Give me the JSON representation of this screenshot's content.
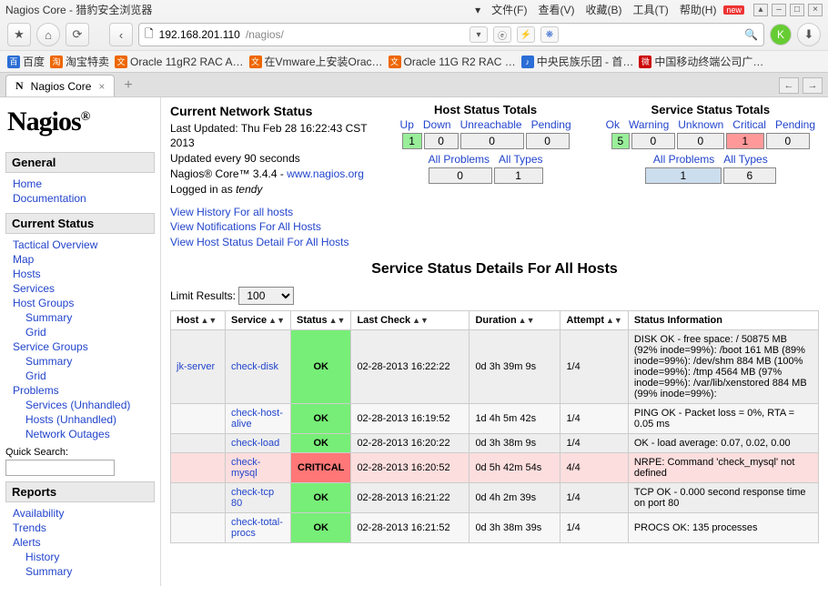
{
  "browser": {
    "title": "Nagios Core - 猎豹安全浏览器",
    "menus": [
      "文件(F)",
      "查看(V)",
      "收藏(B)",
      "工具(T)",
      "帮助(H)"
    ],
    "url_host": "192.168.201.110",
    "url_path": "/nagios/",
    "bookmarks": [
      "百度",
      "淘宝特卖",
      "Oracle 11gR2 RAC A…",
      "在Vmware上安装Orac…",
      "Oracle 11G R2 RAC …",
      "中央民族乐团 - 首…",
      "中国移动终端公司广…"
    ],
    "tab_label": "Nagios Core"
  },
  "sidebar": {
    "logo": "Nagios",
    "general_head": "General",
    "general": [
      "Home",
      "Documentation"
    ],
    "curstat_head": "Current Status",
    "curstat_top": [
      "Tactical Overview",
      "Map",
      "Hosts",
      "Services"
    ],
    "hostgroups_head": "Host Groups",
    "sub1": [
      "Summary",
      "Grid"
    ],
    "servicegroups_head": "Service Groups",
    "sub2": [
      "Summary",
      "Grid"
    ],
    "problems_head": "Problems",
    "problems": [
      "Services (Unhandled)",
      "Hosts (Unhandled)",
      "Network Outages"
    ],
    "quick_search": "Quick Search:",
    "reports_head": "Reports",
    "reports": [
      "Availability",
      "Trends",
      "Alerts"
    ],
    "alerts_sub": [
      "History",
      "Summary"
    ]
  },
  "status": {
    "title": "Current Network Status",
    "updated": "Last Updated: Thu Feb 28 16:22:43 CST 2013",
    "interval": "Updated every 90 seconds",
    "version_pre": "Nagios® Core™ 3.4.4 - ",
    "version_link": "www.nagios.org",
    "login_pre": "Logged in as ",
    "login_user": "tendy",
    "links": [
      "View History For all hosts",
      "View Notifications For All Hosts",
      "View Host Status Detail For All Hosts"
    ]
  },
  "host_totals": {
    "title": "Host Status Totals",
    "labels": [
      "Up",
      "Down",
      "Unreachable",
      "Pending"
    ],
    "counts": [
      "1",
      "0",
      "0",
      "0"
    ],
    "sub_labels": [
      "All Problems",
      "All Types"
    ],
    "sub_counts": [
      "0",
      "1"
    ]
  },
  "svc_totals": {
    "title": "Service Status Totals",
    "labels": [
      "Ok",
      "Warning",
      "Unknown",
      "Critical",
      "Pending"
    ],
    "counts": [
      "5",
      "0",
      "0",
      "1",
      "0"
    ],
    "sub_labels": [
      "All Problems",
      "All Types"
    ],
    "sub_counts": [
      "1",
      "6"
    ]
  },
  "details_title": "Service Status Details For All Hosts",
  "limit": {
    "label": "Limit Results:",
    "value": "100"
  },
  "columns": [
    "Host",
    "Service",
    "Status",
    "Last Check",
    "Duration",
    "Attempt",
    "Status Information"
  ],
  "rows": [
    {
      "host": "jk-server",
      "service": "check-disk",
      "status": "OK",
      "status_class": "ok",
      "last": "02-28-2013 16:22:22",
      "dur": "0d 3h 39m 9s",
      "att": "1/4",
      "info": "DISK OK - free space: / 50875 MB (92% inode=99%): /boot 161 MB (89% inode=99%): /dev/shm 884 MB (100% inode=99%): /tmp 4564 MB (97% inode=99%): /var/lib/xenstored 884 MB (99% inode=99%):",
      "row": "even"
    },
    {
      "host": "",
      "service": "check-host-alive",
      "status": "OK",
      "status_class": "ok",
      "last": "02-28-2013 16:19:52",
      "dur": "1d 4h 5m 42s",
      "att": "1/4",
      "info": "PING OK - Packet loss = 0%, RTA = 0.05 ms",
      "row": "odd"
    },
    {
      "host": "",
      "service": "check-load",
      "status": "OK",
      "status_class": "ok",
      "last": "02-28-2013 16:20:22",
      "dur": "0d 3h 38m 9s",
      "att": "1/4",
      "info": "OK - load average: 0.07, 0.02, 0.00",
      "row": "even"
    },
    {
      "host": "",
      "service": "check-mysql",
      "status": "CRITICAL",
      "status_class": "crit",
      "last": "02-28-2013 16:20:52",
      "dur": "0d 5h 42m 54s",
      "att": "4/4",
      "info": "NRPE: Command 'check_mysql' not defined",
      "row": "critical"
    },
    {
      "host": "",
      "service": "check-tcp 80",
      "status": "OK",
      "status_class": "ok",
      "last": "02-28-2013 16:21:22",
      "dur": "0d 4h 2m 39s",
      "att": "1/4",
      "info": "TCP OK - 0.000 second response time on port 80",
      "row": "even"
    },
    {
      "host": "",
      "service": "check-total-procs",
      "status": "OK",
      "status_class": "ok",
      "last": "02-28-2013 16:21:52",
      "dur": "0d 3h 38m 39s",
      "att": "1/4",
      "info": "PROCS OK: 135 processes",
      "row": "odd"
    }
  ]
}
